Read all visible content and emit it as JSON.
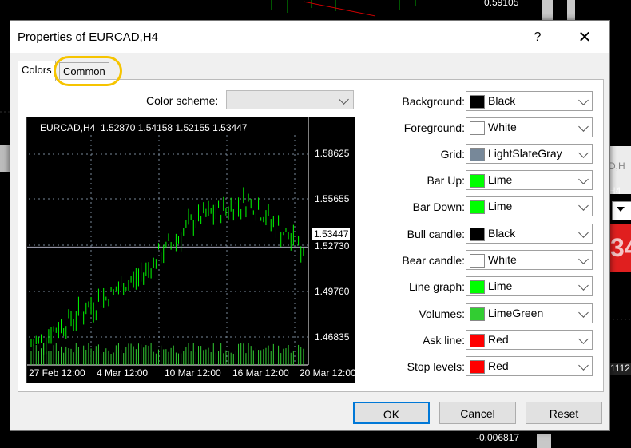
{
  "background": {
    "price_top": "0.59105",
    "symbol_fragment": "H4",
    "red_price_fragment": "34",
    "right_value": "1112",
    "bottom_value": "-0.006817",
    "panel_fragment": "D,H"
  },
  "dialog": {
    "title": "Properties of EURCAD,H4",
    "help_label": "?",
    "close_label": "✕",
    "tabs": [
      {
        "label": "Colors"
      },
      {
        "label": "Common"
      }
    ],
    "color_scheme": {
      "label": "Color scheme:",
      "value": ""
    },
    "properties": [
      {
        "label": "Background:",
        "value": "Black",
        "color": "#000000"
      },
      {
        "label": "Foreground:",
        "value": "White",
        "color": "#ffffff"
      },
      {
        "label": "Grid:",
        "value": "LightSlateGray",
        "color": "#778899"
      },
      {
        "label": "Bar Up:",
        "value": "Lime",
        "color": "#00ff00"
      },
      {
        "label": "Bar Down:",
        "value": "Lime",
        "color": "#00ff00"
      },
      {
        "label": "Bull candle:",
        "value": "Black",
        "color": "#000000"
      },
      {
        "label": "Bear candle:",
        "value": "White",
        "color": "#ffffff"
      },
      {
        "label": "Line graph:",
        "value": "Lime",
        "color": "#00ff00"
      },
      {
        "label": "Volumes:",
        "value": "LimeGreen",
        "color": "#32cd32"
      },
      {
        "label": "Ask line:",
        "value": "Red",
        "color": "#ff0000"
      },
      {
        "label": "Stop levels:",
        "value": "Red",
        "color": "#ff0000"
      }
    ],
    "buttons": {
      "ok": "OK",
      "cancel": "Cancel",
      "reset": "Reset"
    }
  },
  "preview": {
    "header": "EURCAD,H4  1.52870 1.54158 1.52155 1.53447",
    "y_ticks": [
      "1.58625",
      "1.55655",
      "1.52730",
      "1.49760",
      "1.46835"
    ],
    "current_price": "1.53447",
    "x_ticks": [
      "27 Feb 12:00",
      "4 Mar 12:00",
      "10 Mar 12:00",
      "16 Mar 12:00",
      "20 Mar 12:00"
    ]
  },
  "chart_data": {
    "type": "line",
    "title": "EURCAD,H4  1.52870 1.54158 1.52155 1.53447",
    "x": [
      "27 Feb 12:00",
      "4 Mar 12:00",
      "10 Mar 12:00",
      "16 Mar 12:00",
      "20 Mar 12:00"
    ],
    "series": [
      {
        "values": [
          1.468,
          1.492,
          1.515,
          1.552,
          1.566,
          1.531
        ]
      }
    ],
    "ylim": [
      1.455,
      1.61
    ],
    "grid": true
  }
}
